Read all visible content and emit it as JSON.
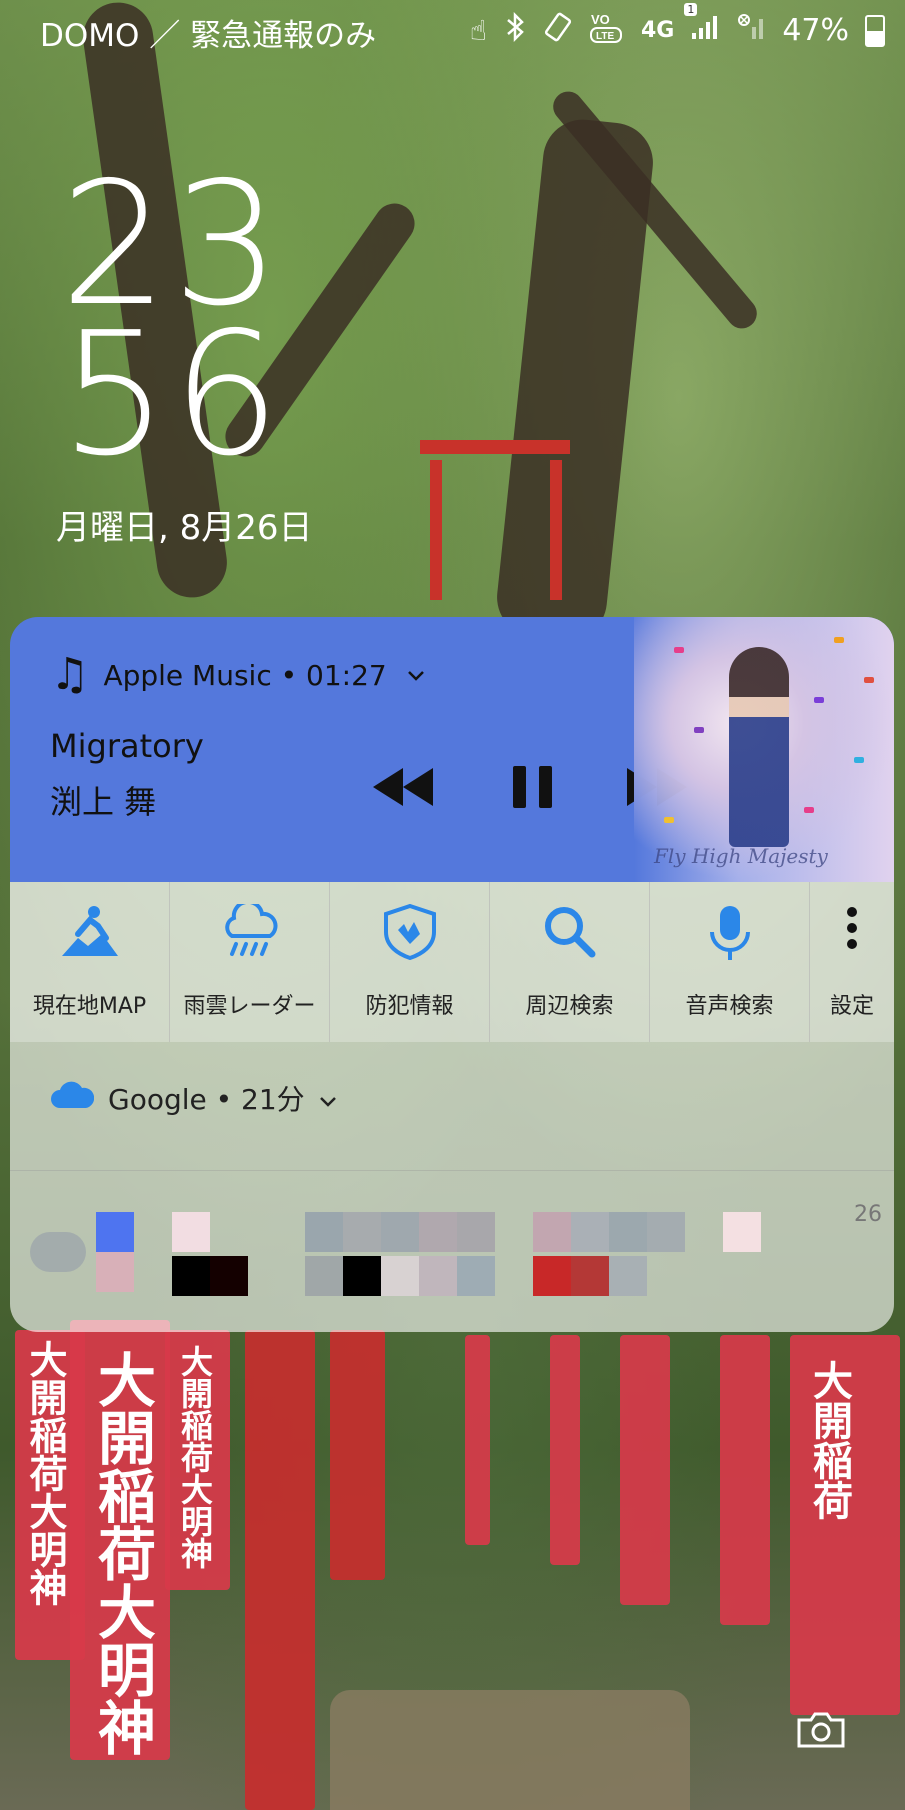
{
  "status_bar": {
    "carrier": "DOMO ／ 緊急通報のみ",
    "battery": "47%",
    "battery_level": 0.47,
    "network": "4G",
    "volte": "VoLTE",
    "sim_badge": "1",
    "icons": [
      "touch-icon",
      "bluetooth-icon",
      "rotate-icon",
      "volte-icon",
      "4g-icon",
      "signal-icon",
      "signal-off-icon",
      "battery-icon"
    ]
  },
  "clock": {
    "hours": "23",
    "minutes": "56",
    "date": "月曜日, 8月26日"
  },
  "music": {
    "app_line": "Apple Music • 01:27",
    "title": "Migratory",
    "artist": "渕上 舞",
    "album_caption": "Fly High Majesty",
    "card_color": "#5478dc"
  },
  "shortcuts": [
    {
      "label": "現在地MAP",
      "icon": "hiking-person-icon"
    },
    {
      "label": "雨雲レーダー",
      "icon": "rain-cloud-icon"
    },
    {
      "label": "防犯情報",
      "icon": "shield-icon"
    },
    {
      "label": "周辺検索",
      "icon": "search-icon"
    },
    {
      "label": "音声検索",
      "icon": "microphone-icon"
    },
    {
      "label": "設定",
      "icon": "more-vert-icon"
    }
  ],
  "google_card": {
    "header": "Google • 21分",
    "time_stub": "26"
  },
  "accent": "#2b87e8"
}
